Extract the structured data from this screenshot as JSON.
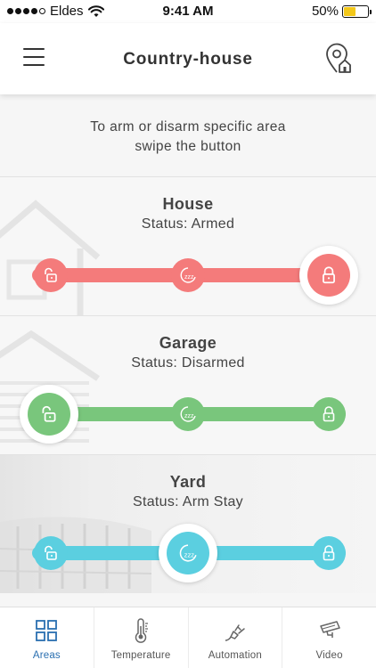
{
  "status_bar": {
    "carrier": "Eldes",
    "time": "9:41 AM",
    "battery": "50%",
    "battery_level": 0.5
  },
  "header": {
    "title": "Country-house"
  },
  "instructions": "To arm or disarm specific area swipe the button",
  "areas": [
    {
      "name": "House",
      "status": "Status: Armed",
      "state": "armed",
      "color": "#f47b7b"
    },
    {
      "name": "Garage",
      "status": "Status: Disarmed",
      "state": "disarmed",
      "color": "#79c67c"
    },
    {
      "name": "Yard",
      "status": "Status: Arm Stay",
      "state": "arm-stay",
      "color": "#5bcfe0"
    }
  ],
  "tabs": [
    {
      "label": "Areas",
      "icon": "grid-icon",
      "active": true
    },
    {
      "label": "Temperature",
      "icon": "thermometer-icon",
      "active": false
    },
    {
      "label": "Automation",
      "icon": "plug-icon",
      "active": false
    },
    {
      "label": "Video",
      "icon": "camera-icon",
      "active": false
    }
  ],
  "colors": {
    "accent": "#2a6fb0",
    "armed": "#f47b7b",
    "disarmed": "#79c67c",
    "arm_stay": "#5bcfe0"
  }
}
